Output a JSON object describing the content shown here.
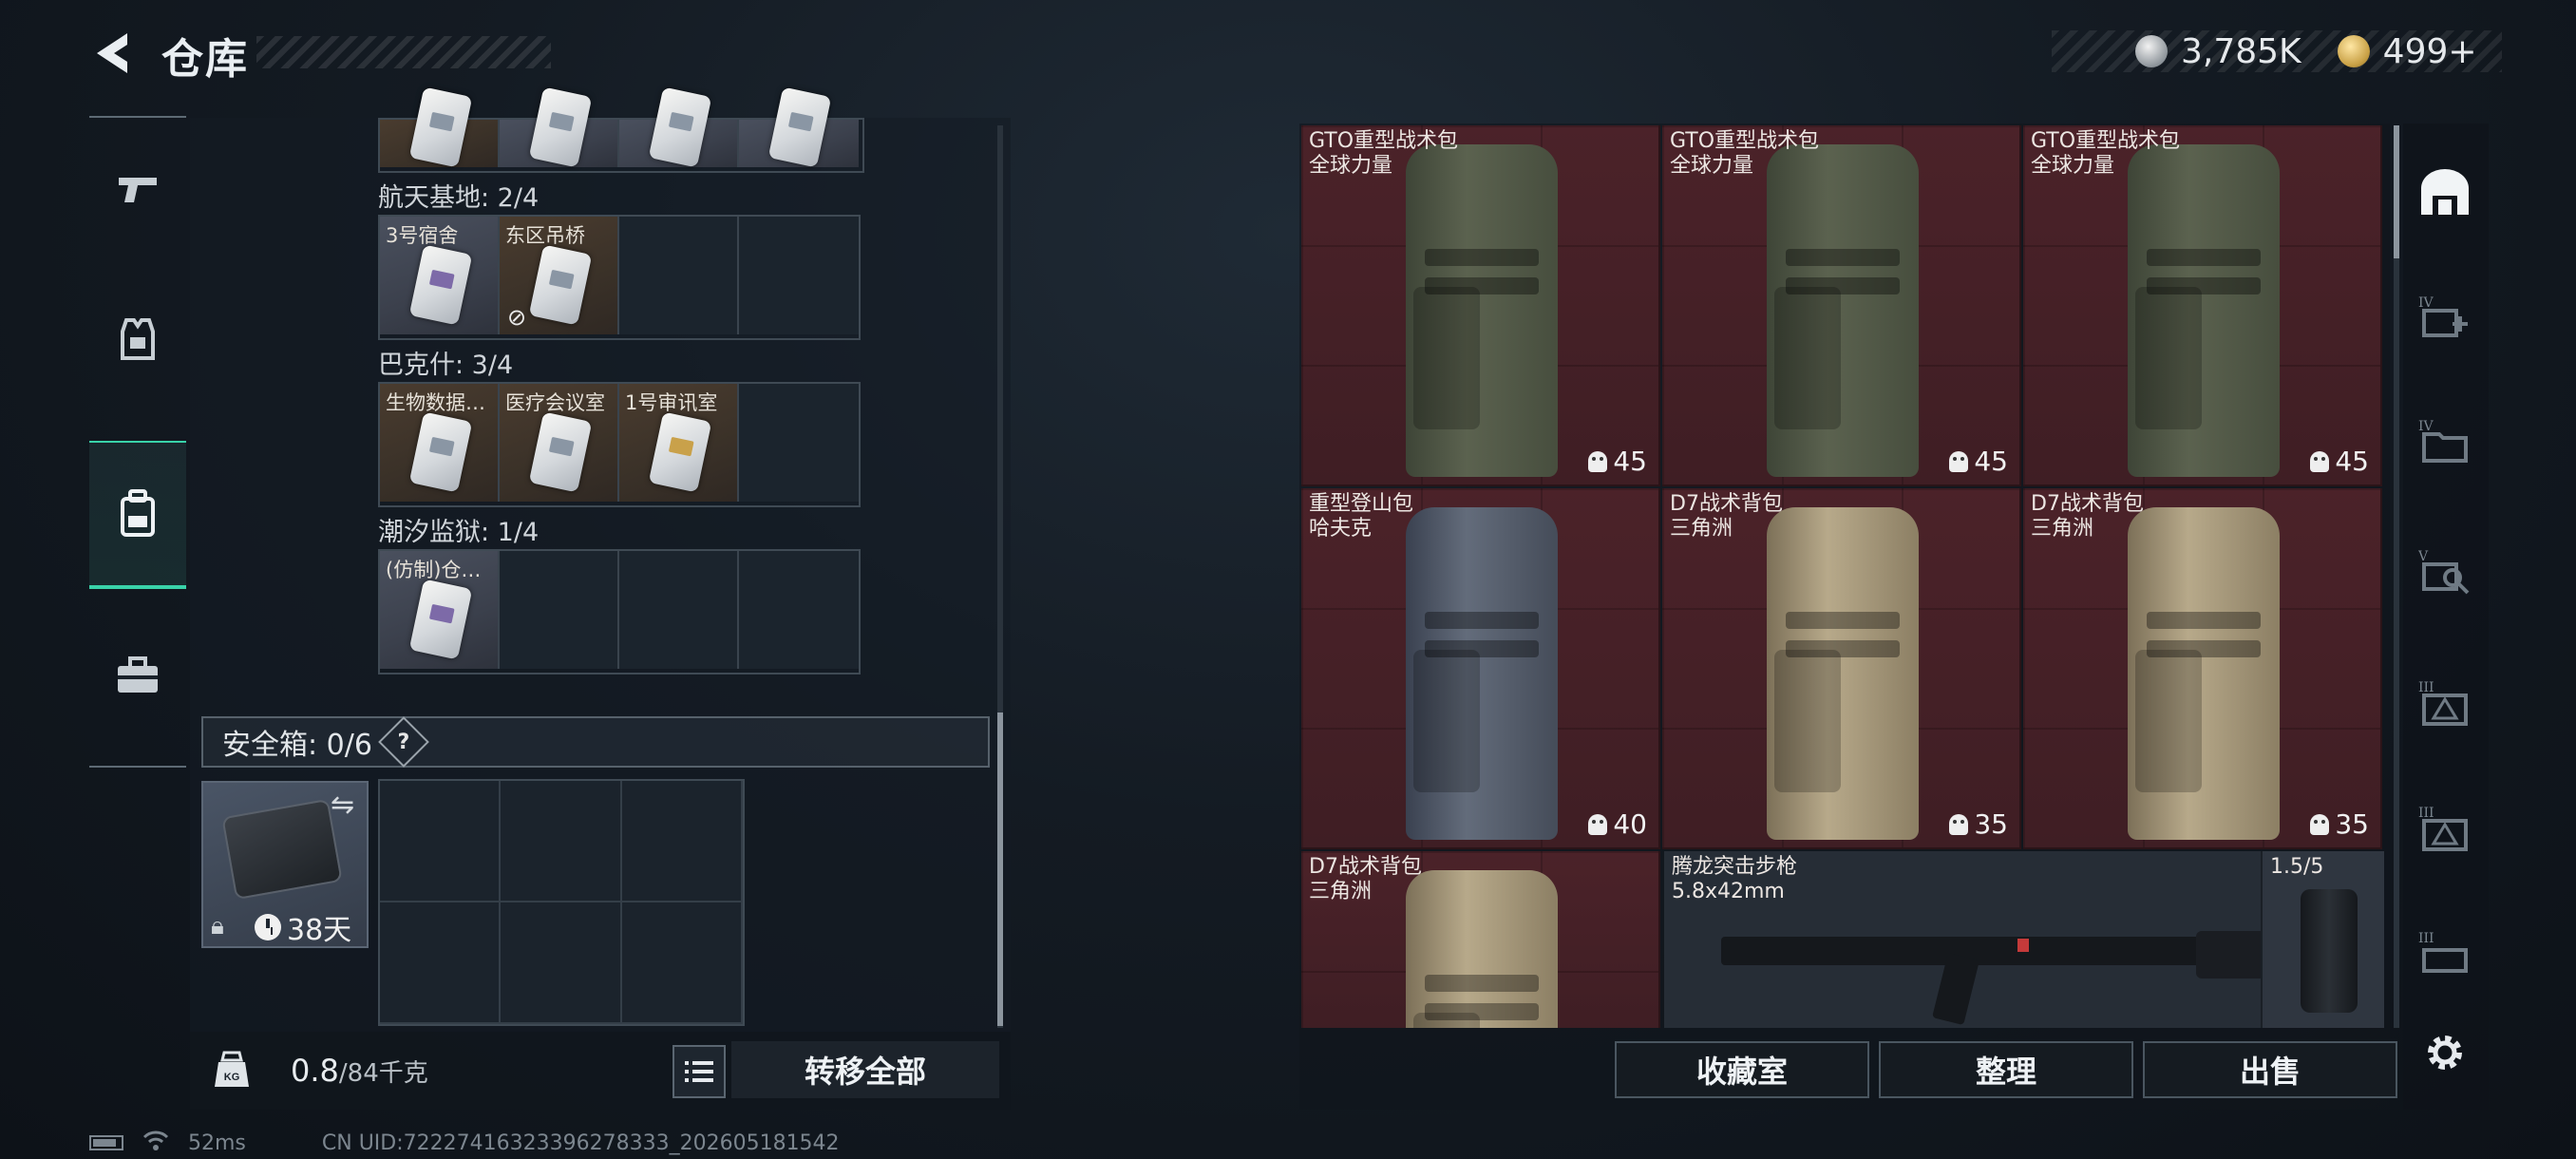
{
  "header": {
    "title": "仓库",
    "currency": {
      "silver": "3,785K",
      "gold": "499+"
    }
  },
  "left_rail": {
    "items": [
      {
        "name": "weapons",
        "icon": "pistol-icon"
      },
      {
        "name": "armor",
        "icon": "armor-vest-icon"
      },
      {
        "name": "backpack",
        "icon": "backpack-icon",
        "active": true
      },
      {
        "name": "toolbox",
        "icon": "toolbox-icon"
      }
    ]
  },
  "keycards": {
    "groups": [
      {
        "label": "航天基地: 2/4",
        "slots": [
          {
            "label": "3号宿舍",
            "color": "blue"
          },
          {
            "label": "东区吊桥",
            "color": "brown",
            "no_entry": true
          },
          null,
          null
        ]
      },
      {
        "label": "巴克什: 3/4",
        "slots": [
          {
            "label": "生物数据…",
            "color": "brown"
          },
          {
            "label": "医疗会议室",
            "color": "brown"
          },
          {
            "label": "1号审讯室",
            "color": "brown"
          },
          null
        ]
      },
      {
        "label": "潮汐监狱: 1/4",
        "slots": [
          {
            "label": "(仿制)仓…",
            "color": "blue"
          },
          null,
          null,
          null
        ]
      }
    ]
  },
  "safe_box": {
    "title": "安全箱: 0/6",
    "help": "?",
    "timer": "38天"
  },
  "left_footer": {
    "weight": "0.8",
    "weight_max": "/84千克",
    "transfer_all": "转移全部"
  },
  "inventory": {
    "items": [
      {
        "name": "GTO重型战术包",
        "sub": "全球力量",
        "count": "45",
        "color": "green"
      },
      {
        "name": "GTO重型战术包",
        "sub": "全球力量",
        "count": "45",
        "color": "green"
      },
      {
        "name": "GTO重型战术包",
        "sub": "全球力量",
        "count": "45",
        "color": "green"
      },
      {
        "name": "重型登山包",
        "sub": "哈夫克",
        "count": "40",
        "color": "grey"
      },
      {
        "name": "D7战术背包",
        "sub": "三角洲",
        "count": "35",
        "color": "tan"
      },
      {
        "name": "D7战术背包",
        "sub": "三角洲",
        "count": "35",
        "color": "tan"
      },
      {
        "name": "D7战术背包",
        "sub": "三角洲",
        "count": "",
        "color": "tan"
      }
    ],
    "weapon": {
      "name": "腾龙突击步枪",
      "sub": "5.8x42mm"
    },
    "scope": {
      "label": "1.5/5"
    }
  },
  "right_footer": {
    "collection": "收藏室",
    "sort": "整理",
    "sell": "出售"
  },
  "right_rail": {
    "levels": [
      "IV",
      "IV",
      "V",
      "III",
      "III",
      "III"
    ]
  },
  "status": {
    "ping": "52ms",
    "uid": "CN UID:72227416323396278333_202605181542"
  }
}
